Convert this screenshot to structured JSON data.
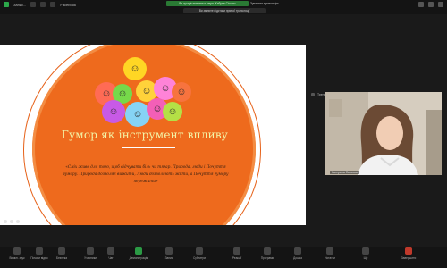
{
  "topbar": {
    "title": "Запис...",
    "app": "Facebook",
    "recording_banner": "Ви зустрічатиметесь мере Жабутів Сістанс",
    "stop_label": "Зупинити трансляцію",
    "message": "Ви зміните підстави прямої трансляції"
  },
  "slide": {
    "title": "Гумор як інструмент впливу",
    "quote": "«Сміх живе для того, щоб відчувати біль чи тягар. Природа, люди і Почуття гумору. Природа дозволяє вижити, Люди дозволяють жити, а Почуття гумору пережити»"
  },
  "video": {
    "side_label": "Тренер Кетрін",
    "name": "Катерина Скичова"
  },
  "controls": [
    {
      "label": "Вимкн. звук",
      "icon": "mic-icon"
    },
    {
      "label": "Почати відео",
      "icon": "video-icon"
    },
    {
      "label": "Безпека",
      "icon": "shield-icon"
    },
    {
      "label": "Учасники",
      "icon": "participants-icon"
    },
    {
      "label": "Чат",
      "icon": "chat-icon"
    },
    {
      "label": "Демонстрація",
      "icon": "share-icon"
    },
    {
      "label": "Запис",
      "icon": "record-icon"
    },
    {
      "label": "Субтитри",
      "icon": "captions-icon"
    },
    {
      "label": "Реакції",
      "icon": "reactions-icon"
    },
    {
      "label": "Програми",
      "icon": "apps-icon"
    },
    {
      "label": "Дошка",
      "icon": "whiteboard-icon"
    },
    {
      "label": "Нотатки",
      "icon": "notes-icon"
    },
    {
      "label": "Ще",
      "icon": "more-icon"
    },
    {
      "label": "Завершити",
      "icon": "end-icon"
    }
  ]
}
